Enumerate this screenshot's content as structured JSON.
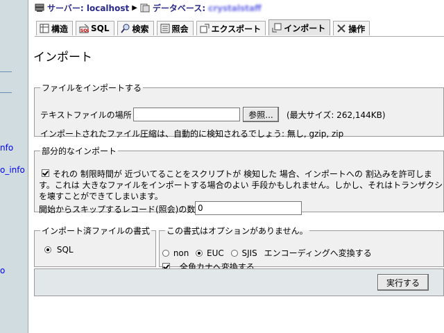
{
  "sidebar": {
    "links": [
      "nfo",
      "o_info",
      "o"
    ]
  },
  "breadcrumb": {
    "server_label": "サーバー: localhost",
    "db_label": "データベース:",
    "db_name": "crystalstaff"
  },
  "tabs": [
    {
      "label": "構造",
      "icon": "structure-icon"
    },
    {
      "label": "SQL",
      "icon": "sql-icon"
    },
    {
      "label": "検索",
      "icon": "search-icon"
    },
    {
      "label": "照会",
      "icon": "query-icon"
    },
    {
      "label": "エクスポート",
      "icon": "export-icon"
    },
    {
      "label": "インポート",
      "icon": "import-icon",
      "active": true
    },
    {
      "label": "操作",
      "icon": "operations-icon"
    }
  ],
  "page_title": "インポート",
  "file_section": {
    "legend": "ファイルをインポートする",
    "file_label": "テキストファイルの場所",
    "file_value": "",
    "browse_label": "参照...",
    "max_size": "(最大サイズ: 262,144KB)",
    "compression_note": "インポートされたファイル圧縮は、自動的に検知されるでしょう: 無し, gzip, zip"
  },
  "partial_section": {
    "legend": "部分的なインポート",
    "allow_interrupt_checked": true,
    "allow_interrupt_line1": "それの 制限時間が 近づいてることをスクリプトが 検知した 場合、インポートへの 割込みを許可しま",
    "allow_interrupt_line2": "す。これは 大きなファイルをインポートする場合のよい 手段かもしれません。しかし、それはトランザクション",
    "allow_interrupt_line3": "を壊すことができてしまいます。",
    "skip_label": "開始からスキップするレコード(照会)の数",
    "skip_value": "0"
  },
  "format_section": {
    "legend": "インポート済ファイルの書式",
    "options": [
      "SQL"
    ],
    "selected": "SQL"
  },
  "options_section": {
    "legend": "この書式はオプションがありません。",
    "encoding_options": [
      "non",
      "EUC",
      "SJIS"
    ],
    "encoding_selected": "EUC",
    "encoding_label": "エンコーディングへ変換する",
    "kana_checked": true,
    "kana_label": "全角カナへ変換する"
  },
  "submit_label": "実行する"
}
